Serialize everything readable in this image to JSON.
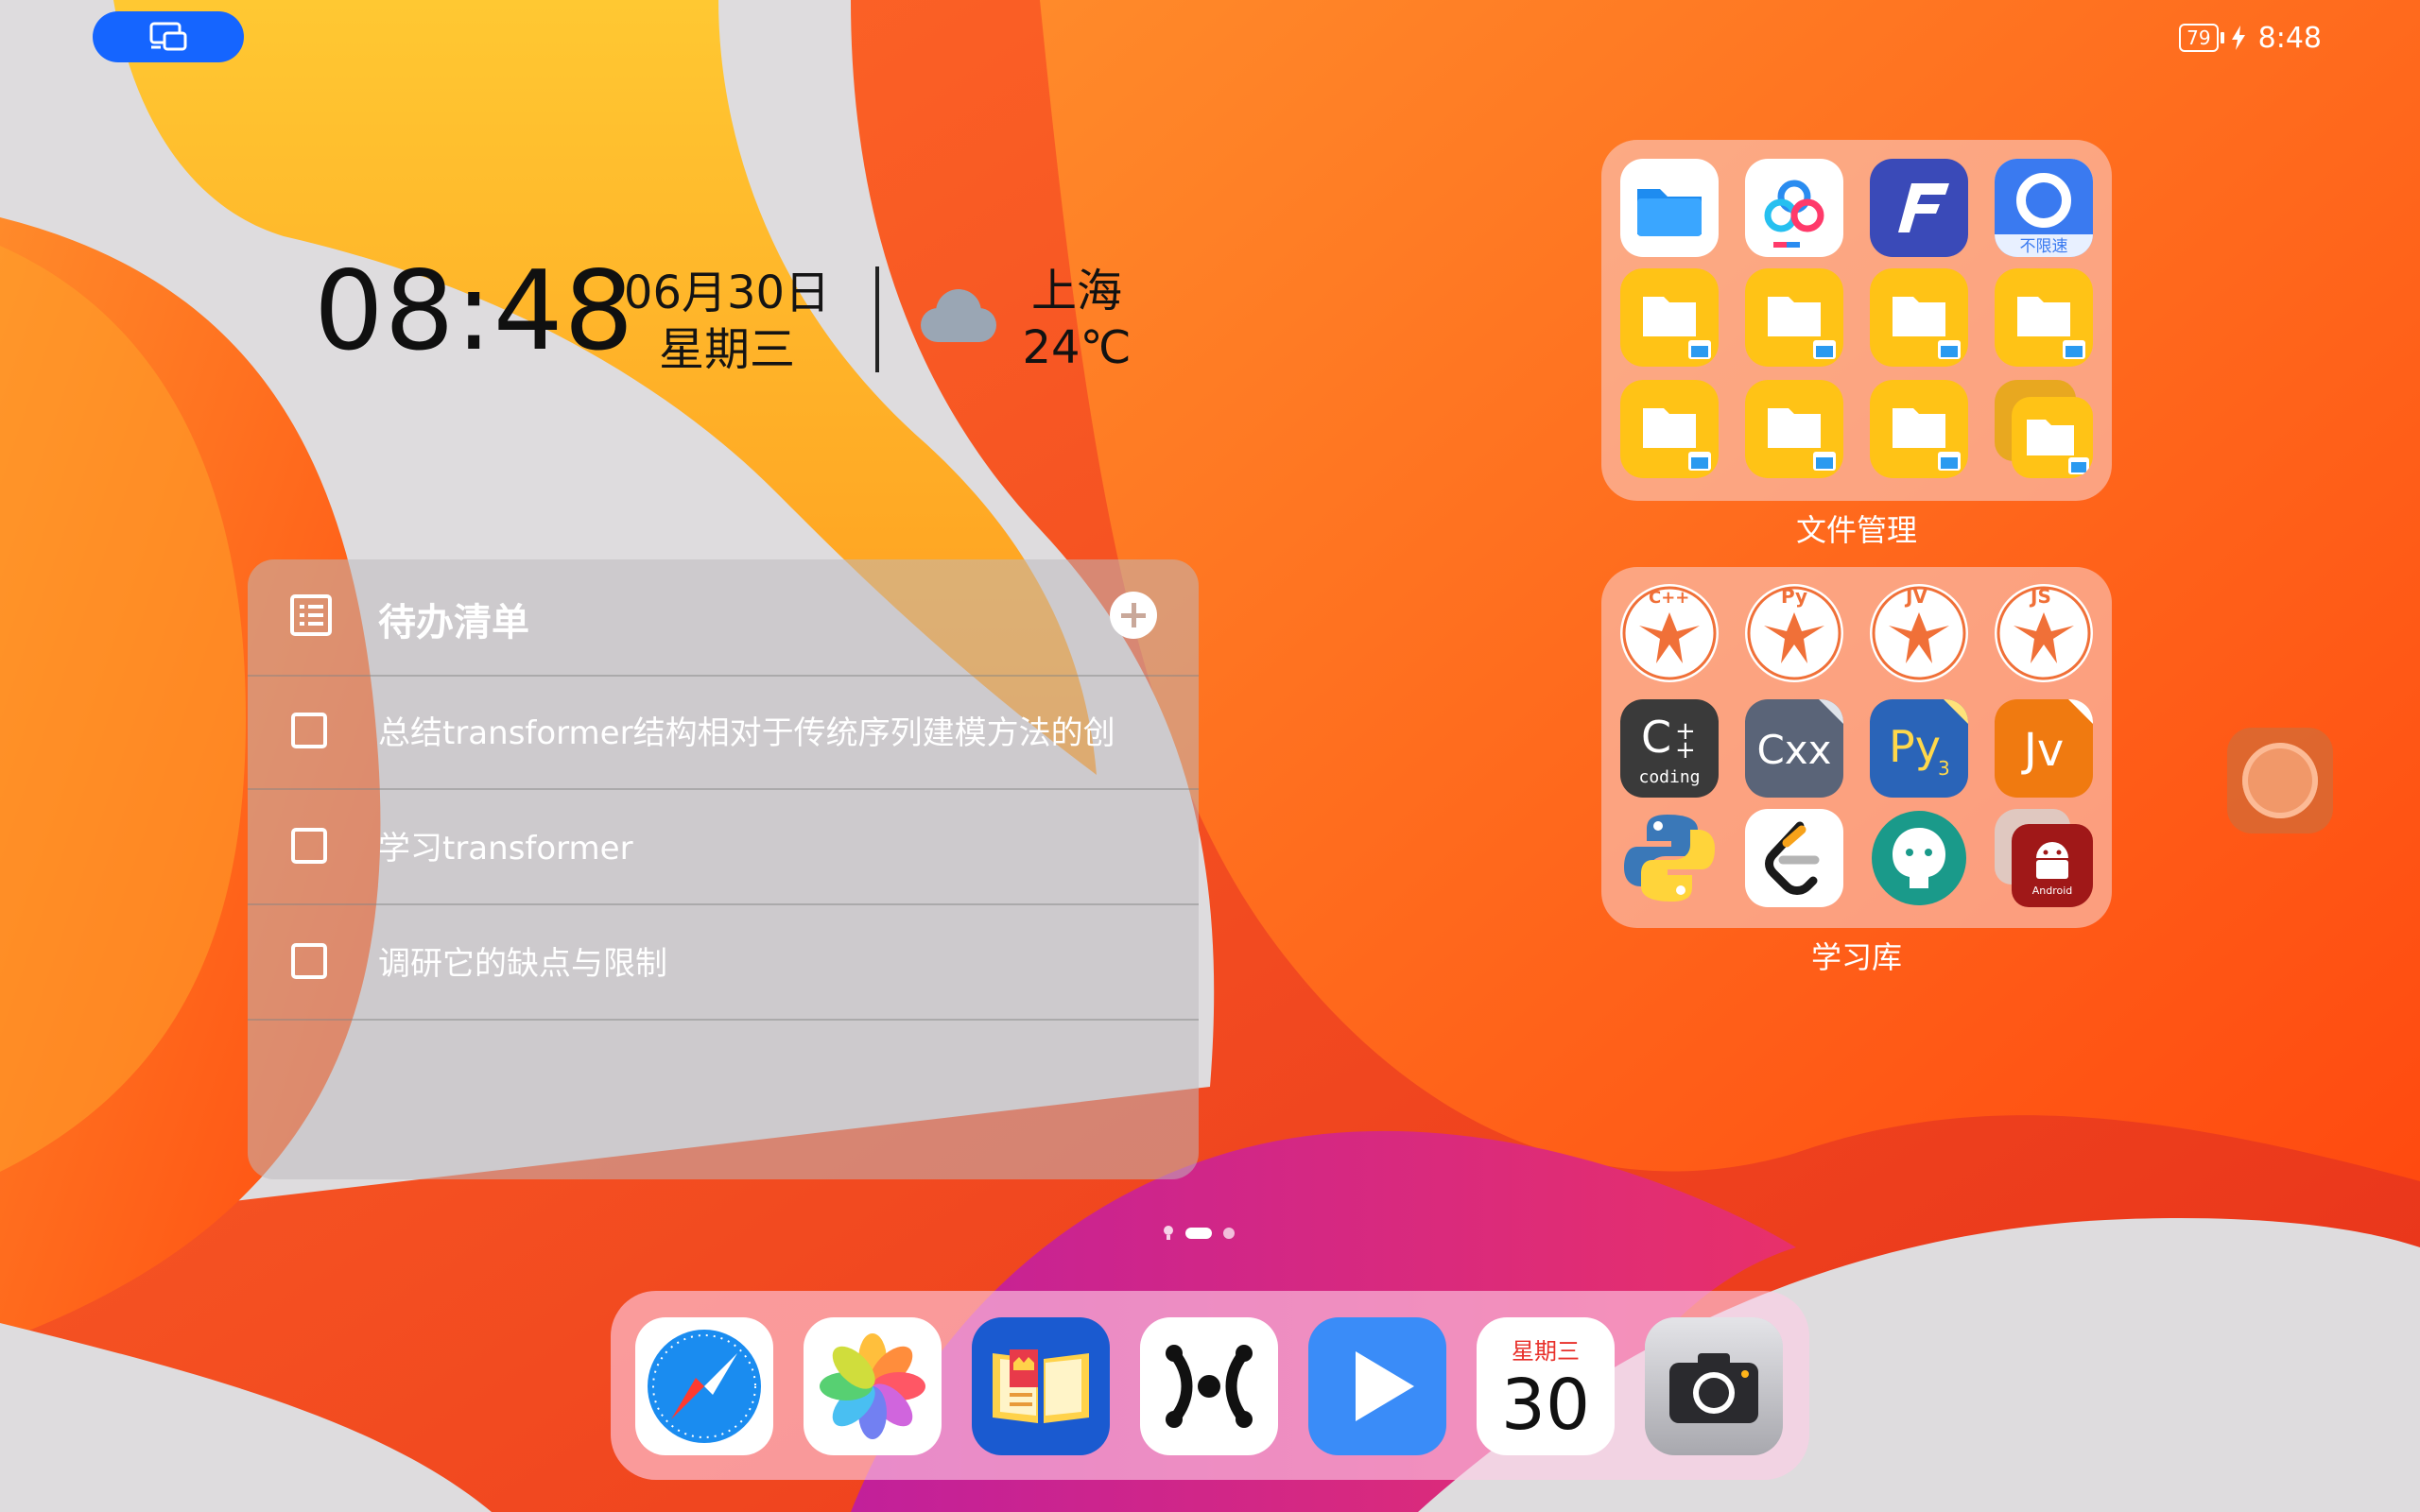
{
  "status_bar": {
    "battery": "79",
    "time": "8:48"
  },
  "clock_widget": {
    "time": "08:48",
    "date": "06月30日",
    "weekday": "星期三",
    "city": "上海",
    "temperature": "24℃",
    "weather_icon": "cloud-icon"
  },
  "todo_widget": {
    "title": "待办清单",
    "items": [
      {
        "text": "总结transformer结构相对于传统序列建模方法的创",
        "checked": false
      },
      {
        "text": "学习transformer",
        "checked": false
      },
      {
        "text": "调研它的缺点与限制",
        "checked": false
      }
    ]
  },
  "folders": {
    "file_manager": {
      "label": "文件管理",
      "apps": [
        "files-app-icon",
        "baidu-netdisk-icon",
        "fe-file-explorer-icon",
        "xunlei-icon",
        "folder-shortcut-icon",
        "folder-shortcut-icon",
        "folder-shortcut-icon",
        "folder-shortcut-icon",
        "folder-shortcut-icon",
        "folder-shortcut-icon",
        "folder-shortcut-icon",
        "folder-stack-icon"
      ],
      "xunlei_badge": "不限速"
    },
    "study_library": {
      "label": "学习库",
      "apps": [
        "cpp-bird-icon",
        "py-bird-icon",
        "jv-bird-icon",
        "js-bird-icon",
        "c-coding-icon",
        "cxx-icon",
        "py3-icon",
        "jv-icon",
        "python-icon",
        "leetcode-icon",
        "github-icon",
        "android-dev-icon"
      ],
      "bird_labels": [
        "C++",
        "Py",
        "JV",
        "JS"
      ],
      "coding_label": "coding",
      "cxx_label": "Cxx",
      "py3_label": "Py",
      "jv_label": "Jv",
      "android_label": "Android"
    }
  },
  "dock": {
    "apps": [
      "safari-icon",
      "photos-icon",
      "books-icon",
      "mind-map-icon",
      "video-play-icon",
      "calendar-icon",
      "camera-icon"
    ],
    "calendar_weekday": "星期三",
    "calendar_day": "30"
  },
  "page_indicator": {
    "pages": 2,
    "current": 1
  }
}
